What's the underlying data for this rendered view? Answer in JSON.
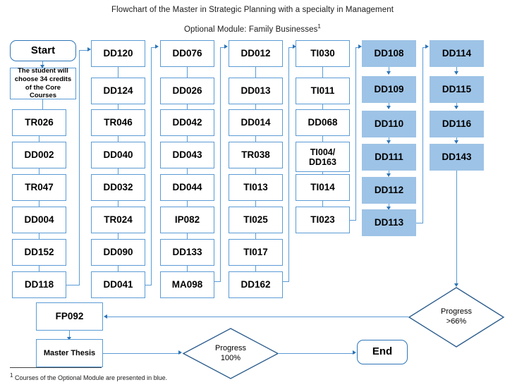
{
  "header": {
    "title": "Flowchart of the Master in Strategic Planning with a specialty in Management",
    "subtitle": "Optional Module: Family Businesses",
    "subtitle_superscript": "1"
  },
  "colors": {
    "box_border": "#5B9BD5",
    "optional_module_fill": "#9DC3E6",
    "connector": "#5B9BD5",
    "terminator_border": "#2E75B6",
    "diamond_border": "#2E5E8E"
  },
  "terminators": {
    "start": "Start",
    "end": "End"
  },
  "note": {
    "text": "The student will choose 34 credits of the Core Courses"
  },
  "columns": [
    {
      "id": "column-1",
      "optional": false,
      "nodes": [
        "TR026",
        "DD002",
        "TR047",
        "DD004",
        "DD152",
        "DD118"
      ]
    },
    {
      "id": "column-2",
      "optional": false,
      "nodes": [
        "DD120",
        "DD124",
        "TR046",
        "DD040",
        "DD032",
        "TR024",
        "DD090",
        "DD041"
      ]
    },
    {
      "id": "column-3",
      "optional": false,
      "nodes": [
        "DD076",
        "DD026",
        "DD042",
        "DD043",
        "DD044",
        "IP082",
        "DD133",
        "MA098"
      ]
    },
    {
      "id": "column-4",
      "optional": false,
      "nodes": [
        "DD012",
        "DD013",
        "DD014",
        "TR038",
        "TI013",
        "TI025",
        "TI017",
        "DD162"
      ]
    },
    {
      "id": "column-5",
      "optional": false,
      "nodes": [
        "TI030",
        "TI011",
        "DD068",
        "TI004/\nDD163",
        "TI014",
        "TI023"
      ]
    },
    {
      "id": "column-6",
      "optional": true,
      "nodes": [
        "DD108",
        "DD109",
        "DD110",
        "DD111",
        "DD112",
        "DD113"
      ]
    },
    {
      "id": "column-7",
      "optional": true,
      "nodes": [
        "DD114",
        "DD115",
        "DD116",
        "DD143"
      ]
    }
  ],
  "decisions": {
    "progress_66": {
      "line1": "Progress",
      "line2": ">66%"
    },
    "progress_100": {
      "line1": "Progress",
      "line2": "100%"
    }
  },
  "final_nodes": {
    "fp092": "FP092",
    "master_thesis": "Master Thesis"
  },
  "footnote": {
    "marker": "1",
    "text": "Courses of the Optional Module are presented in blue."
  }
}
